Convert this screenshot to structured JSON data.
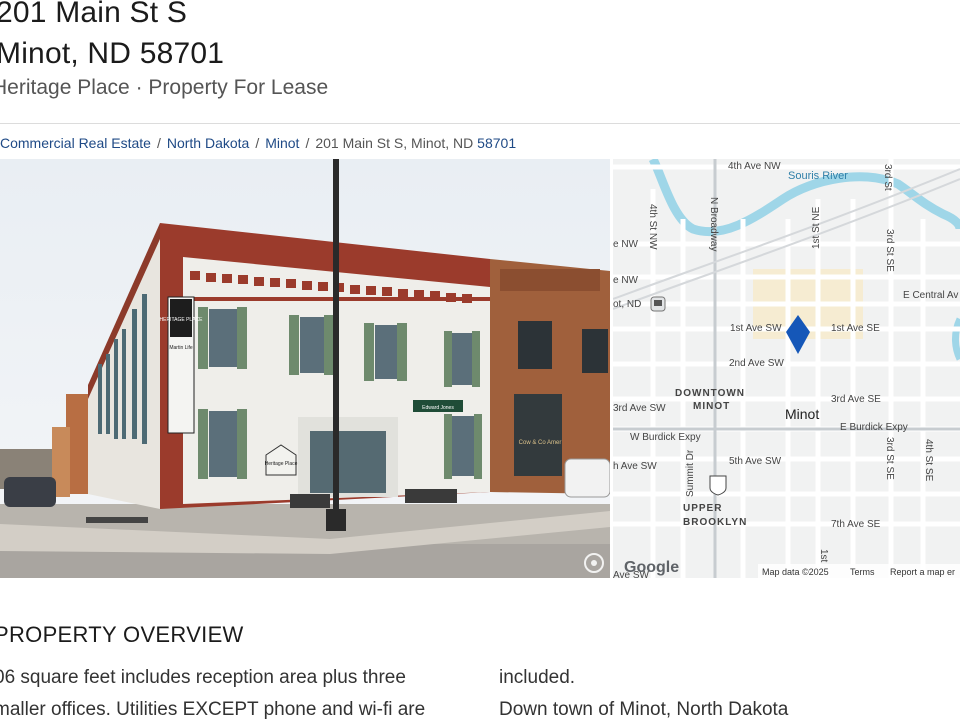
{
  "header": {
    "title_line1": "201 Main St S",
    "title_line2": "Minot, ND 58701",
    "subtitle": "Heritage Place · Property For Lease"
  },
  "breadcrumb": {
    "items": [
      "Commercial Real Estate",
      "North Dakota",
      "Minot"
    ],
    "current_address": "201 Main St S, Minot, ND",
    "current_zip": "58701",
    "separator": "/"
  },
  "photo": {
    "building_signs": [
      "HERITAGE PLACE",
      "Martin Life",
      "Edward Jones",
      "Heritage Place",
      "Cow & Co Amer"
    ],
    "icon": "gallery-icon"
  },
  "map": {
    "labels": {
      "ave_nw_4th": "4th Ave NW",
      "souris_river": "Souris River",
      "st_se_3rd_top": "3rd St",
      "st_nw_4th": "4th St NW",
      "n_broadway": "N Broadway",
      "st_se_3rd": "3rd St SE",
      "ave_nw_a": "e NW",
      "ave_nw_b": "e NW",
      "e_central_ave": "E Central Av",
      "st_ne_1st": "1st St NE",
      "ot_nd": "ot, ND",
      "ave_sw_1st": "1st Ave SW",
      "ave_se_1st": "1st Ave SE",
      "ave_sw_2nd": "2nd Ave SW",
      "downtown_1": "DOWNTOWN",
      "downtown_2": "MINOT",
      "minot": "Minot",
      "ave_se_3rd": "3rd Ave SE",
      "ave_sw_3rd": "3rd Ave SW",
      "w_burdick": "W Burdick Expy",
      "e_burdick": "E Burdick Expy",
      "st_se_3rd_b": "3rd St SE",
      "st_se_4th": "4th St SE",
      "ave_sw_4th": "h Ave SW",
      "ave_sw_5th": "5th Ave SW",
      "summit_dr": "Summit Dr",
      "route": "83",
      "upper_1": "UPPER",
      "upper_2": "BROOKLYN",
      "ave_se_7th": "7th Ave SE",
      "st_1st_bottom": "1st",
      "ave_sw_bottom": "Ave SW"
    },
    "google_logo": "Google",
    "map_data": "Map data ©2025",
    "terms": "Terms",
    "report": "Report a map er",
    "colors": {
      "water": "#9fd6e8",
      "road": "#ffffff",
      "pin": "#1557b8",
      "land": "#f1f2f2",
      "urban": "#f6ecd2"
    }
  },
  "overview": {
    "heading": "PROPERTY OVERVIEW",
    "left_lines": [
      "06 square feet includes reception area plus three",
      "maller offices. Utilities EXCEPT phone and wi-fi are"
    ],
    "right_lines": [
      "included.",
      "Down town of Minot, North Dakota"
    ]
  }
}
